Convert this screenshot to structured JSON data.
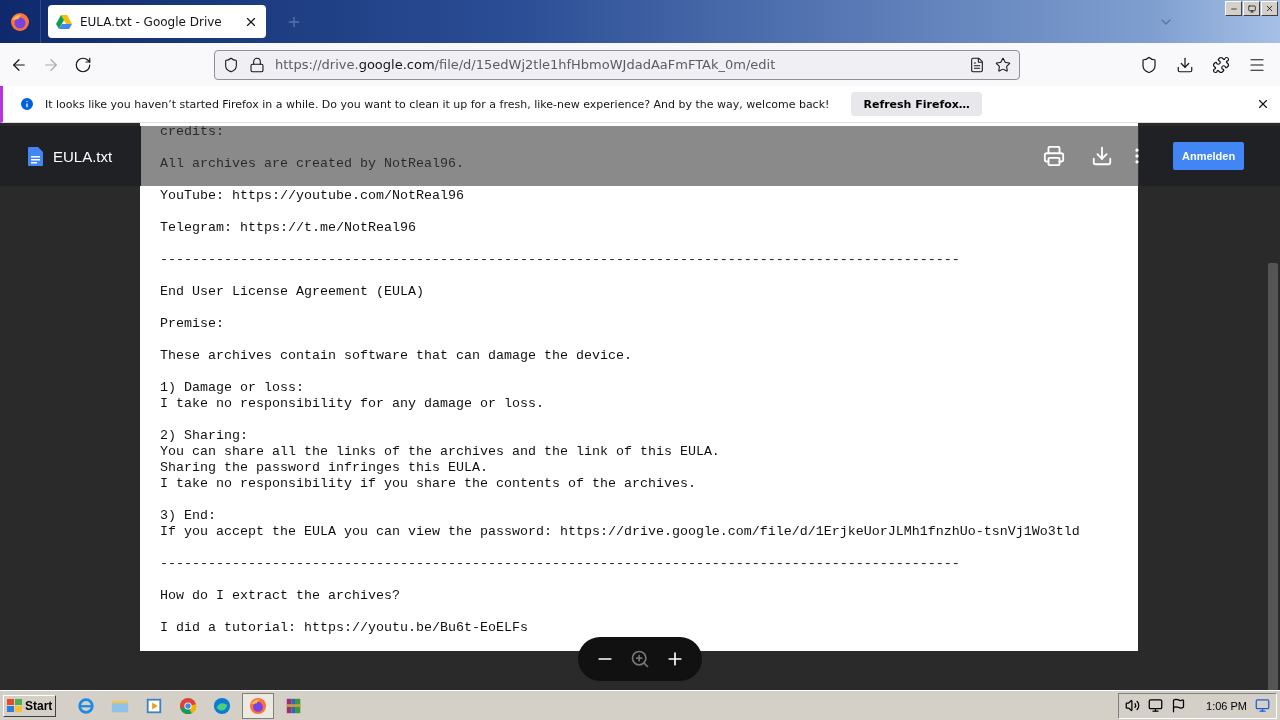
{
  "browser": {
    "tabs": [
      {
        "title": "EULA.txt - Google Drive",
        "selected": true
      }
    ],
    "url": {
      "prefix": "https://drive.",
      "domain": "google.com",
      "path": "/file/d/15edWj2tle1hfHbmoWJdadAaFmFTAk_0m/edit"
    }
  },
  "notification": {
    "message": "It looks like you haven’t started Firefox in a while. Do you want to clean it up for a fresh, like-new experience? And by the way, welcome back!",
    "button": "Refresh Firefox…"
  },
  "viewer": {
    "file_name": "EULA.txt",
    "sign_in": "Anmelden"
  },
  "document": {
    "blocks": [
      [
        "credits:"
      ],
      [
        "All archives are created by NotReal96."
      ],
      [
        "YouTube: https://youtube.com/NotReal96"
      ],
      [
        "Telegram: https://t.me/NotReal96"
      ],
      [
        "----------------------------------------------------------------------------------------------------"
      ],
      [
        "End User License Agreement (EULA)"
      ],
      [
        "Premise:"
      ],
      [
        "These archives contain software that can damage the device."
      ],
      [
        "1) Damage or loss:",
        "I take no responsibility for any damage or loss."
      ],
      [
        "2) Sharing:",
        "You can share all the links of the archives and the link of this EULA.",
        "Sharing the password infringes this EULA.",
        "I take no responsibility if you share the contents of the archives."
      ],
      [
        "3) End:",
        "If you accept the EULA you can view the password: https://drive.google.com/file/d/1ErjkeUorJLMh1fnzhUo-tsnVj1Wo3tld"
      ],
      [
        "----------------------------------------------------------------------------------------------------"
      ],
      [
        "How do I extract the archives?"
      ],
      [
        "I did a tutorial: https://youtu.be/Bu6t-EoELFs"
      ]
    ]
  },
  "taskbar": {
    "start": "Start",
    "apps": [
      {
        "kind": "ie",
        "selected": false
      },
      {
        "kind": "folder",
        "selected": false
      },
      {
        "kind": "media",
        "selected": false
      },
      {
        "kind": "chrome",
        "selected": false
      },
      {
        "kind": "edge",
        "selected": false
      },
      {
        "kind": "firefox",
        "selected": true
      },
      {
        "kind": "archive",
        "selected": false
      }
    ],
    "clock": "1:06 PM"
  }
}
